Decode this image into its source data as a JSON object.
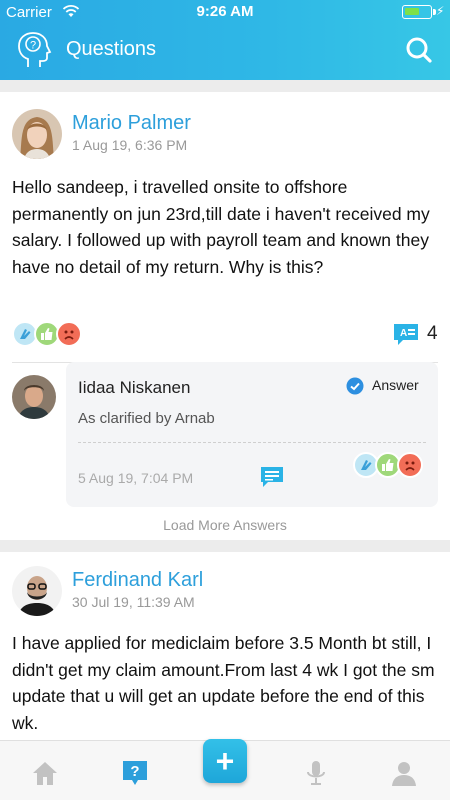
{
  "status_bar": {
    "carrier": "Carrier",
    "time": "9:26 AM"
  },
  "header": {
    "title": "Questions"
  },
  "questions": [
    {
      "author": "Mario Palmer",
      "date": "1 Aug 19, 6:36 PM",
      "text": "Hello sandeep, i travelled onsite to offshore permanently on jun 23rd,till date i haven't received my salary. I followed up with payroll team and known they have no detail of my return. Why is this?",
      "comment_count": "4",
      "answer": {
        "author": "Iidaa Niskanen",
        "badge": "Answer",
        "text": "As clarified by Arnab",
        "date": "5 Aug 19, 7:04 PM"
      },
      "load_more": "Load More Answers"
    },
    {
      "author": "Ferdinand Karl",
      "date": "30 Jul 19, 11:39 AM",
      "text": "I have applied for mediclaim before 3.5 Month bt still, I didn't get my claim amount.From last 4 wk I got the sm update that u will get an update before the end of this wk."
    }
  ],
  "colors": {
    "accent": "#2d9fdb",
    "header_start": "#2aa9e3",
    "header_end": "#37c7e6"
  },
  "tabs": [
    "home-icon",
    "questions-icon",
    "add-icon",
    "microphone-icon",
    "profile-icon"
  ]
}
